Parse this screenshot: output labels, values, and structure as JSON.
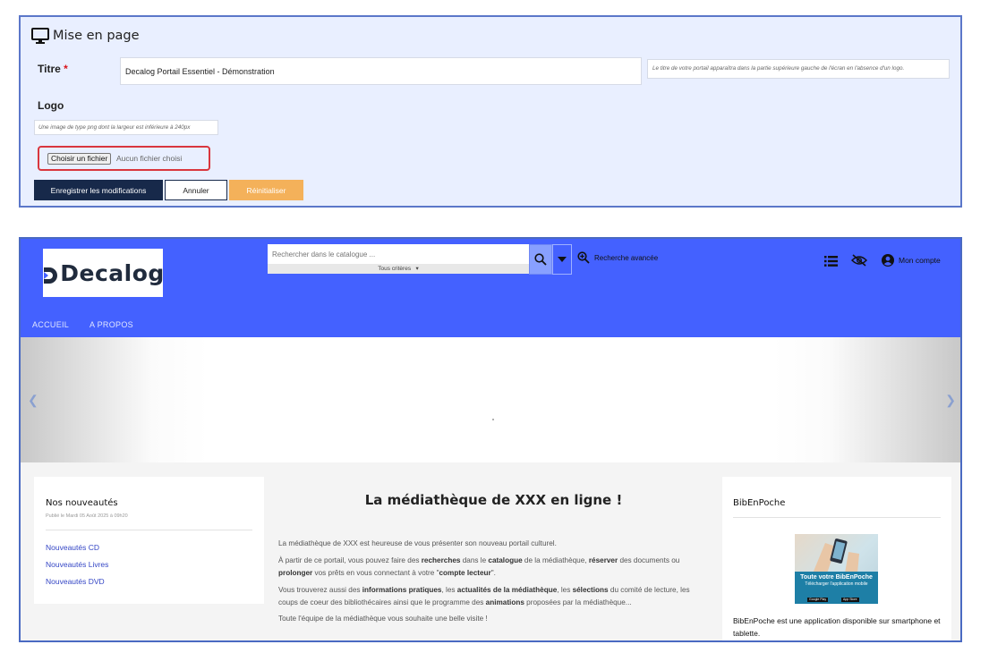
{
  "settings": {
    "section_title": "Mise en page",
    "title_label": "Titre",
    "required_mark": "*",
    "title_value": "Decalog Portail Essentiel - Démonstration",
    "title_hint": "Le titre de votre portail apparaîtra dans la partie supérieure gauche de l'écran en l'absence d'un logo.",
    "logo_label": "Logo",
    "logo_hint": "Une image de type png dont la largeur est inférieure à 240px",
    "file_button": "Choisir un fichier",
    "file_status": "Aucun fichier choisi",
    "save_label": "Enregistrer les modifications",
    "cancel_label": "Annuler",
    "reset_label": "Réinitialiser"
  },
  "portal": {
    "logo_text": "Decalog",
    "search_placeholder": "Rechercher dans le catalogue ...",
    "criteria_label": "Tous critères",
    "advanced_search": "Recherche avancée",
    "account_label": "Mon compte",
    "nav": [
      "ACCUEIL",
      "A PROPOS"
    ],
    "news": {
      "title": "Nos nouveautés",
      "date": "Publié le Mardi 05 Août 2025 à 09h20",
      "links": [
        "Nouveautés CD",
        "Nouveautés Livres",
        "Nouveautés DVD"
      ]
    },
    "main": {
      "title": "La médiathèque de XXX en ligne !",
      "p1": "La médiathèque de XXX est heureuse de vous présenter son nouveau portail culturel.",
      "p2_html": "À partir de ce portail, vous pouvez faire des <b>recherches</b> dans le <b>catalogue</b> de la médiathèque, <b>réserver</b> des documents ou <b>prolonger</b> vos prêts en vous connectant à votre \"<b>compte lecteur</b>\".",
      "p3_html": "Vous trouverez aussi des <b>informations pratiques</b>, les <b>actualités de la médiathèque</b>, les <b>sélections</b> du comité de lecture, les coups de coeur des bibliothécaires ainsi que le programme des <b>animations</b> proposées par la médiathèque...",
      "p4": "Toute l'équipe de la médiathèque vous souhaite une belle visite !"
    },
    "bib": {
      "title": "BibEnPoche",
      "banner_title": "Toute votre BibEnPoche",
      "banner_sub": "Télécharger l'application mobile",
      "badge_google": "Google Play",
      "badge_apple": "App Store",
      "description": "BibEnPoche est une application disponible sur smartphone et tablette."
    }
  },
  "colors": {
    "header_blue": "#4461ff",
    "save_button": "#17294a",
    "reset_button": "#f4b15a",
    "link_blue": "#3446c5",
    "required_red": "#d9141b"
  }
}
